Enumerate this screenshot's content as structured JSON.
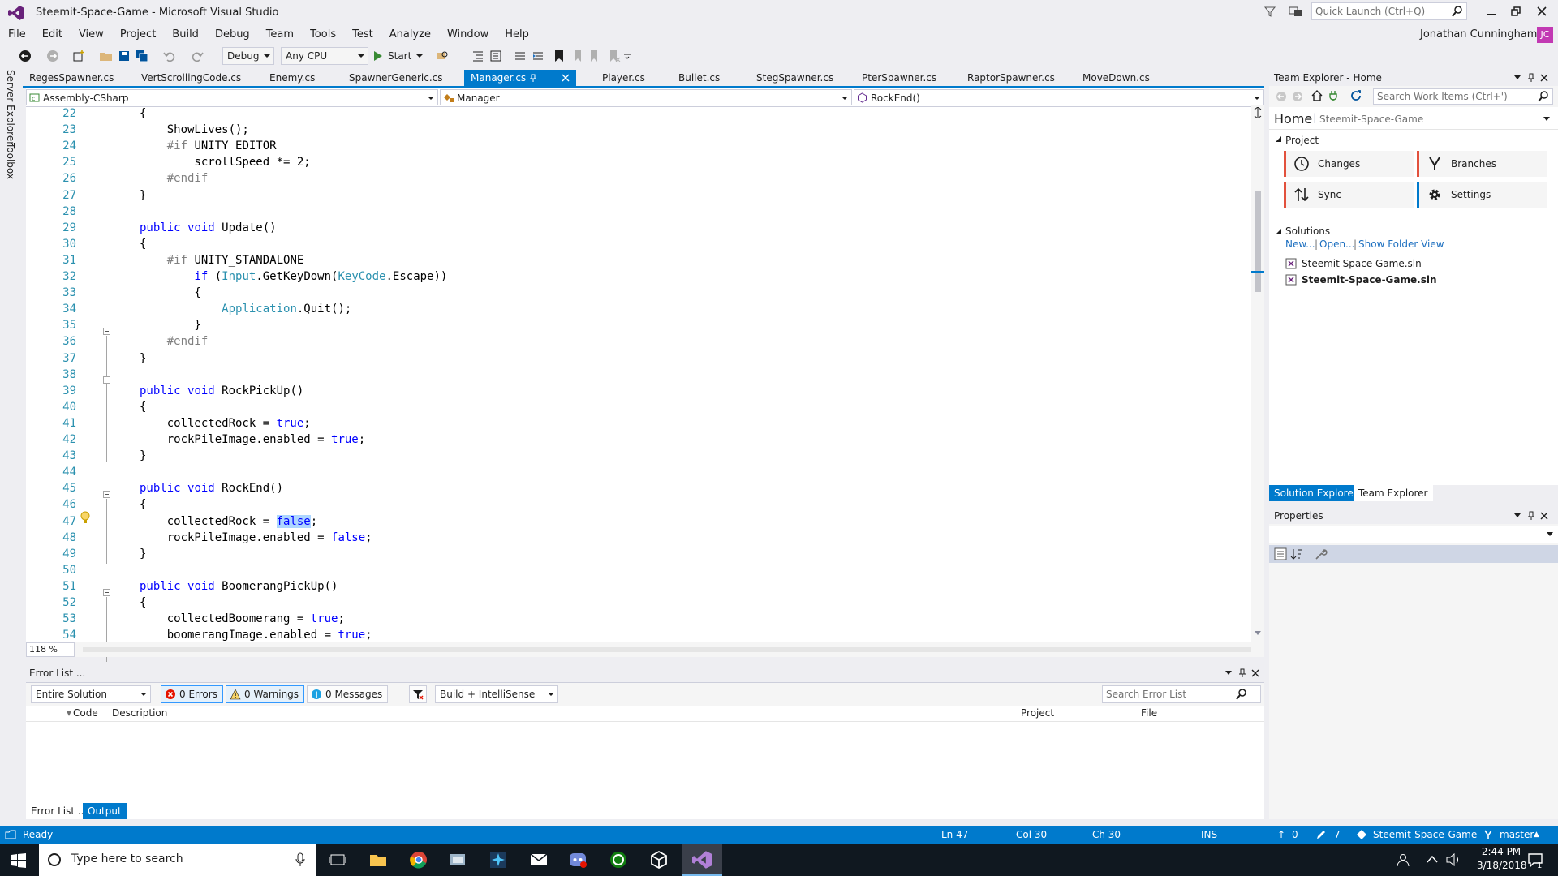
{
  "window": {
    "title": "Steemit-Space-Game - Microsoft Visual Studio",
    "quick_launch_placeholder": "Quick Launch (Ctrl+Q)",
    "user_name": "Jonathan Cunningham",
    "user_initials": "JC"
  },
  "menu": [
    "File",
    "Edit",
    "View",
    "Project",
    "Build",
    "Debug",
    "Team",
    "Tools",
    "Test",
    "Analyze",
    "Window",
    "Help"
  ],
  "toolbar": {
    "config": "Debug",
    "platform": "Any CPU",
    "start_label": "Start"
  },
  "left_tabs": [
    "Server Explorer",
    "Toolbox"
  ],
  "doc_tabs": [
    "RegesSpawner.cs",
    "VertScrollingCode.cs",
    "Enemy.cs",
    "SpawnerGeneric.cs",
    "Manager.cs",
    "Player.cs",
    "Bullet.cs",
    "StegSpawner.cs",
    "PterSpawner.cs",
    "RaptorSpawner.cs",
    "MoveDown.cs"
  ],
  "active_tab": "Manager.cs",
  "nav": {
    "project": "Assembly-CSharp",
    "class": "Manager",
    "member": "RockEnd()"
  },
  "zoom": "118 %",
  "editor_lines": [
    {
      "n": "22",
      "html": "{"
    },
    {
      "n": "23",
      "html": "    ShowLives();"
    },
    {
      "n": "24",
      "html": "    <span class=\"pp\">#if</span> UNITY_EDITOR"
    },
    {
      "n": "25",
      "html": "        scrollSpeed *= 2;"
    },
    {
      "n": "26",
      "html": "    <span class=\"pp\">#endif</span>"
    },
    {
      "n": "27",
      "html": "}"
    },
    {
      "n": "28",
      "html": ""
    },
    {
      "n": "29",
      "html": "<span class=\"kw\">public</span> <span class=\"kw\">void</span> Update()"
    },
    {
      "n": "30",
      "html": "{"
    },
    {
      "n": "31",
      "html": "    <span class=\"pp\">#if</span> UNITY_STANDALONE"
    },
    {
      "n": "32",
      "html": "        <span class=\"kw\">if</span> (<span class=\"ty\">Input</span>.GetKeyDown(<span class=\"ty\">KeyCode</span>.Escape))"
    },
    {
      "n": "33",
      "html": "        {"
    },
    {
      "n": "34",
      "html": "            <span class=\"ty\">Application</span>.Quit();"
    },
    {
      "n": "35",
      "html": "        }"
    },
    {
      "n": "36",
      "html": "    <span class=\"pp\">#endif</span>"
    },
    {
      "n": "37",
      "html": "}"
    },
    {
      "n": "38",
      "html": ""
    },
    {
      "n": "39",
      "html": "<span class=\"kw\">public</span> <span class=\"kw\">void</span> RockPickUp()"
    },
    {
      "n": "40",
      "html": "{"
    },
    {
      "n": "41",
      "html": "    collectedRock = <span class=\"kw\">true</span>;"
    },
    {
      "n": "42",
      "html": "    rockPileImage.enabled = <span class=\"kw\">true</span>;"
    },
    {
      "n": "43",
      "html": "}"
    },
    {
      "n": "44",
      "html": ""
    },
    {
      "n": "45",
      "html": "<span class=\"kw\">public</span> <span class=\"kw\">void</span> RockEnd()"
    },
    {
      "n": "46",
      "html": "{"
    },
    {
      "n": "47",
      "html": "    collectedRock = <span class=\"kw hl\">false</span>;"
    },
    {
      "n": "48",
      "html": "    rockPileImage.enabled = <span class=\"kw\">false</span>;"
    },
    {
      "n": "49",
      "html": "}"
    },
    {
      "n": "50",
      "html": ""
    },
    {
      "n": "51",
      "html": "<span class=\"kw\">public</span> <span class=\"kw\">void</span> BoomerangPickUp()"
    },
    {
      "n": "52",
      "html": "{"
    },
    {
      "n": "53",
      "html": "    collectedBoomerang = <span class=\"kw\">true</span>;"
    },
    {
      "n": "54",
      "html": "    boomerangImage.enabled = <span class=\"kw\">true</span>;"
    }
  ],
  "error_list": {
    "title": "Error List ...",
    "scope": "Entire Solution",
    "errors": "0 Errors",
    "warnings": "0 Warnings",
    "messages": "0 Messages",
    "filter": "Build + IntelliSense",
    "search_placeholder": "Search Error List",
    "columns": [
      "Code",
      "Description",
      "Project",
      "File"
    ]
  },
  "bottom_tabs": [
    "Error List ...",
    "Output"
  ],
  "team_explorer": {
    "title": "Team Explorer - Home",
    "search_placeholder": "Search Work Items (Ctrl+')",
    "home": "Home",
    "repo": "Steemit-Space-Game",
    "project_header": "Project",
    "tiles": [
      "Changes",
      "Branches",
      "Sync",
      "Settings"
    ],
    "solutions_header": "Solutions",
    "links": [
      "New...",
      "Open...",
      "Show Folder View"
    ],
    "solutions": [
      "Steemit Space Game.sln",
      "Steemit-Space-Game.sln"
    ]
  },
  "panel_tabs": [
    "Solution Explorer",
    "Team Explorer"
  ],
  "properties": {
    "title": "Properties"
  },
  "status": {
    "ready": "Ready",
    "ln": "Ln 47",
    "col": "Col 30",
    "ch": "Ch 30",
    "ins": "INS",
    "up": "0",
    "edits": "7",
    "repo": "Steemit-Space-Game",
    "branch": "master"
  },
  "taskbar": {
    "search_placeholder": "Type here to search",
    "time": "2:44 PM",
    "date": "3/18/2018",
    "badge": "1"
  },
  "colors": {
    "accent": "#007acc",
    "vs_purple": "#68217a",
    "user_badge": "#c239b3"
  }
}
